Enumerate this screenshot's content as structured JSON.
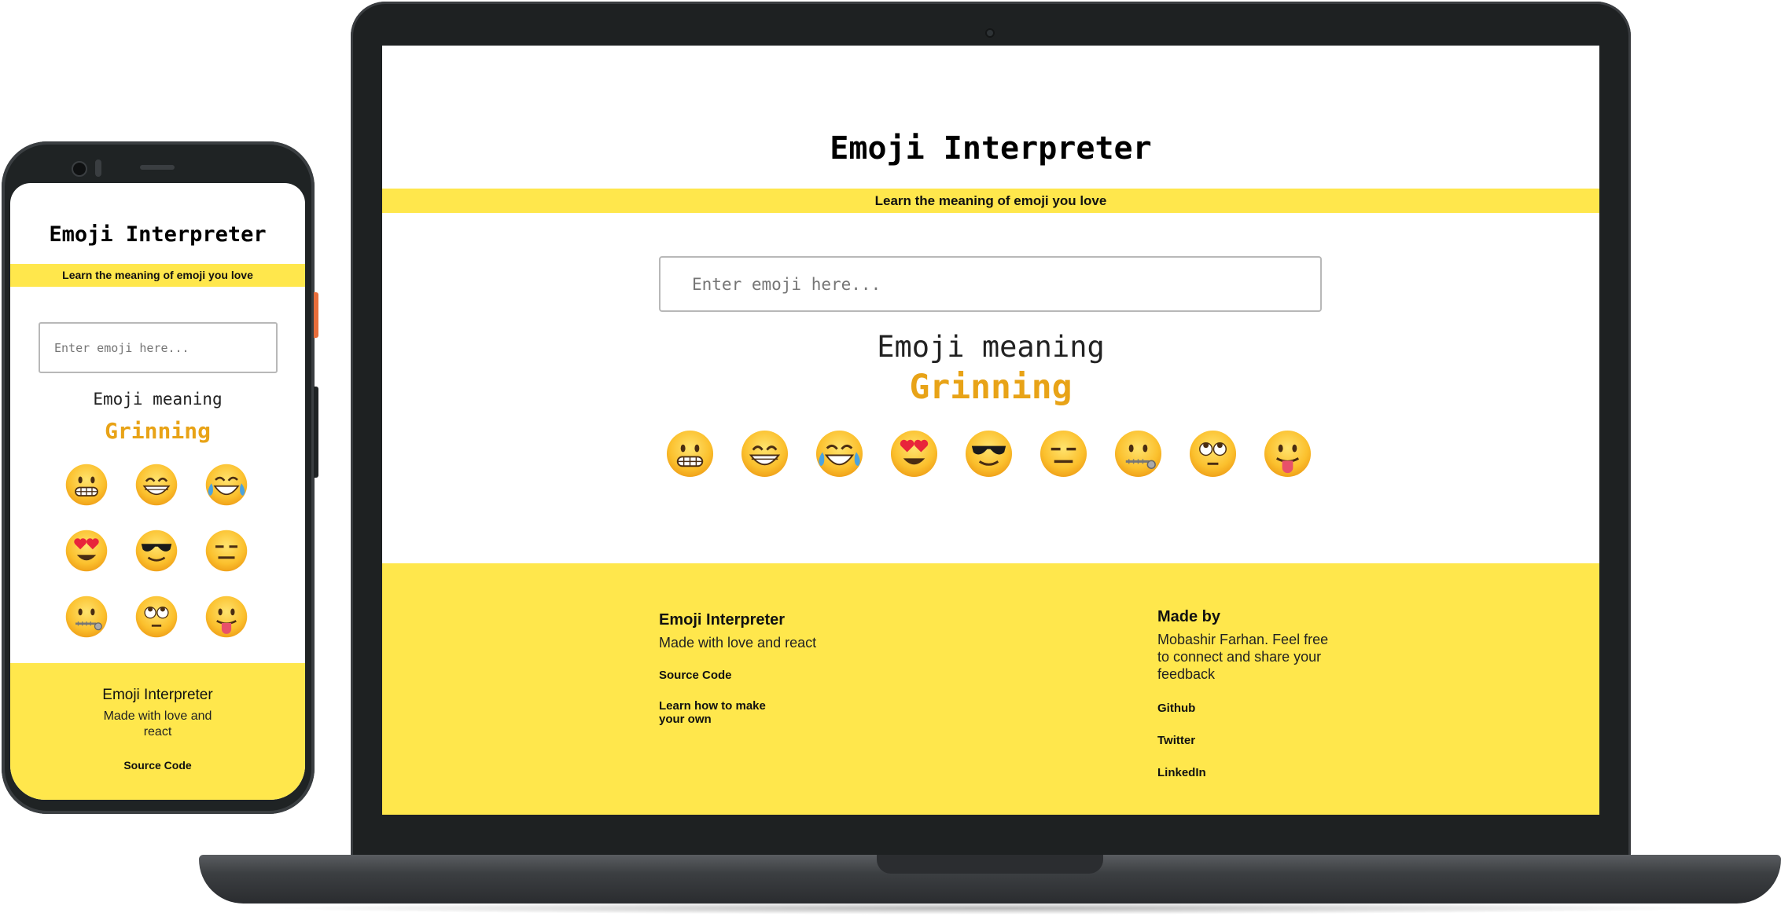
{
  "laptop": {
    "title": "Emoji Interpreter",
    "tagline": "Learn the meaning of emoji you love",
    "input_placeholder": "Enter emoji here...",
    "meaning_label": "Emoji meaning",
    "meaning_value": "Grinning",
    "emojis": [
      "grimacing",
      "grinning-eyes",
      "tears-of-joy",
      "heart-eyes",
      "sunglasses",
      "expressionless",
      "zipper-mouth",
      "rolling-eyes",
      "tongue-out"
    ],
    "footer": {
      "left_title": "Emoji Interpreter",
      "left_text": "Made with love and react",
      "source_code": "Source Code",
      "learn_link": "Learn how to make your own",
      "right_title": "Made by",
      "right_text": "Mobashir Farhan. Feel free to connect and share your feedback",
      "github": "Github",
      "twitter": "Twitter",
      "linkedin": "LinkedIn"
    }
  },
  "phone": {
    "title": "Emoji Interpreter",
    "tagline": "Learn the meaning of emoji you love",
    "input_placeholder": "Enter emoji here...",
    "meaning_label": "Emoji meaning",
    "meaning_value": "Grinning",
    "footer": {
      "title": "Emoji Interpreter",
      "text": "Made with love and react",
      "source_code": "Source Code"
    }
  },
  "colors": {
    "accent_yellow": "#ffe74c",
    "meaning_orange": "#e8a317",
    "device_dark": "#1e2122"
  }
}
